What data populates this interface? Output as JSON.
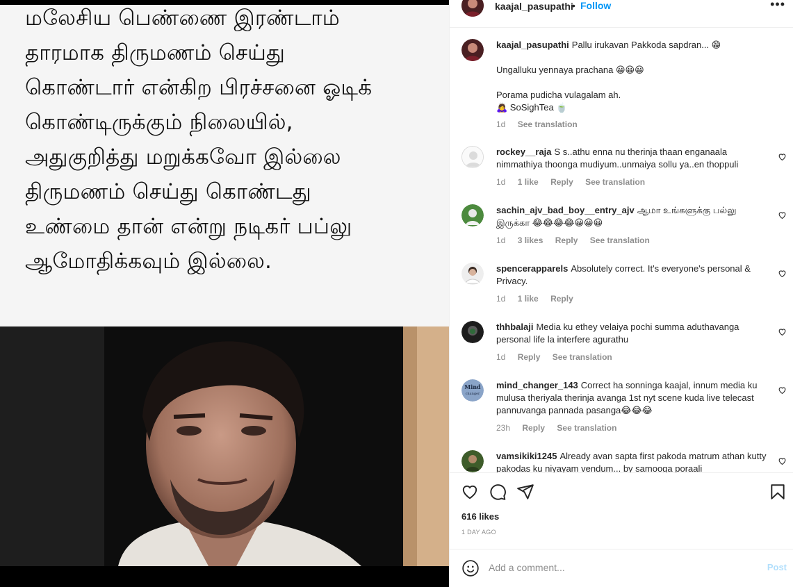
{
  "media": {
    "text_lines": [
      "மலேசிய பெண்ணை இரண்டாம்",
      "தாரமாக திருமணம் செய்து",
      "கொண்டார் என்கிற பிரச்சனை ஓடிக்",
      "கொண்டிருக்கும் நிலையில்,",
      "அதுகுறித்து மறுக்கவோ இல்லை",
      "திருமணம் செய்து கொண்டது",
      "உண்மை தான் என்று நடிகர் பப்லு",
      "ஆமோதிக்கவும் இல்லை."
    ]
  },
  "header": {
    "username": "kaajal_pasupathi",
    "separator": "•",
    "follow_label": "Follow",
    "more_label": "•••"
  },
  "caption": {
    "username": "kaajal_pasupathi",
    "lines": [
      "Pallu irukavan Pakkoda sapdran... 😁",
      "Ungalluku yennaya prachana 😀😀😀",
      "Porama pudicha vulagalam ah.",
      "🙇‍♀️ SoSighTea 🍵"
    ],
    "time": "1d",
    "see_translation": "See translation"
  },
  "comments": [
    {
      "username": "rockey__raja",
      "text": "S s..athu enna nu therinja thaan enganaala nimmathiya thoonga mudiyum..unmaiya sollu ya..en thoppuli",
      "time": "1d",
      "likes": "1 like",
      "reply": "Reply",
      "see_translation": "See translation"
    },
    {
      "username": "sachin_ajv_bad_boy__entry_ajv",
      "text": "ஆமா உங்களுக்கு பல்லு இருக்கா 😂😂😂😂😀😀😀",
      "time": "1d",
      "likes": "3 likes",
      "reply": "Reply",
      "see_translation": "See translation"
    },
    {
      "username": "spencerapparels",
      "text": "Absolutely correct. It's everyone's personal & Privacy.",
      "time": "1d",
      "likes": "1 like",
      "reply": "Reply"
    },
    {
      "username": "thhbalaji",
      "text": "Media ku ethey velaiya pochi summa aduthavanga personal life la interfere agurathu",
      "time": "1d",
      "reply": "Reply",
      "see_translation": "See translation"
    },
    {
      "username": "mind_changer_143",
      "text": "Correct ha sonninga kaajal, innum media ku mulusa theriyala therinja avanga 1st nyt scene kuda live telecast pannuvanga pannada pasanga😂😂😂",
      "time": "23h",
      "reply": "Reply",
      "see_translation": "See translation"
    },
    {
      "username": "vamsikiki1245",
      "text": "Already avan sapta first pakoda matrum athan kutty pakodas ku niyayam vendum... by samooga poraali"
    }
  ],
  "actions": {
    "likes": "616 likes",
    "time_ago": "1 DAY AGO"
  },
  "add_comment": {
    "placeholder": "Add a comment...",
    "post_label": "Post"
  },
  "colors": {
    "link_blue": "#0095f6",
    "post_disabled": "#b2dffc",
    "muted": "#8e8e8e"
  }
}
